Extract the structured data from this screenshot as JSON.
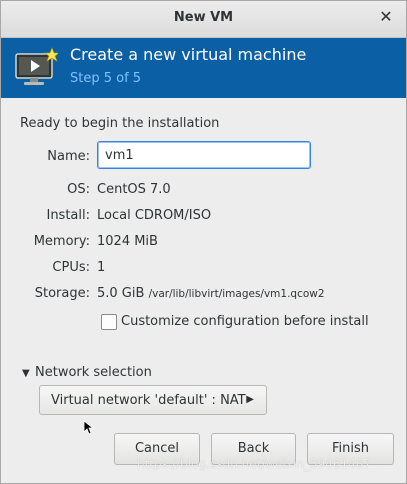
{
  "window": {
    "title": "New VM",
    "close_icon": "close-icon"
  },
  "banner": {
    "icon": "monitor-new-icon",
    "title": "Create a new virtual machine",
    "step": "Step 5 of 5",
    "bg_color": "#0b5fa5",
    "step_color": "#7fc3ff"
  },
  "summary": {
    "heading": "Ready to begin the installation",
    "name_label": "Name:",
    "name_value": "vm1",
    "os_label": "OS:",
    "os_value": "CentOS 7.0",
    "install_label": "Install:",
    "install_value": "Local CDROM/ISO",
    "memory_label": "Memory:",
    "memory_value": "1024 MiB",
    "cpus_label": "CPUs:",
    "cpus_value": "1",
    "storage_label": "Storage:",
    "storage_size": "5.0 GiB",
    "storage_path": "/var/lib/libvirt/images/vm1.qcow2",
    "customize_label": "Customize configuration before install",
    "customize_checked": false
  },
  "network": {
    "expander_label": "Network selection",
    "selection": "Virtual network 'default' : NAT"
  },
  "buttons": {
    "cancel": "Cancel",
    "back": "Back",
    "finish": "Finish"
  },
  "watermark": "https://blog.csdn.net/weixin_39461487"
}
